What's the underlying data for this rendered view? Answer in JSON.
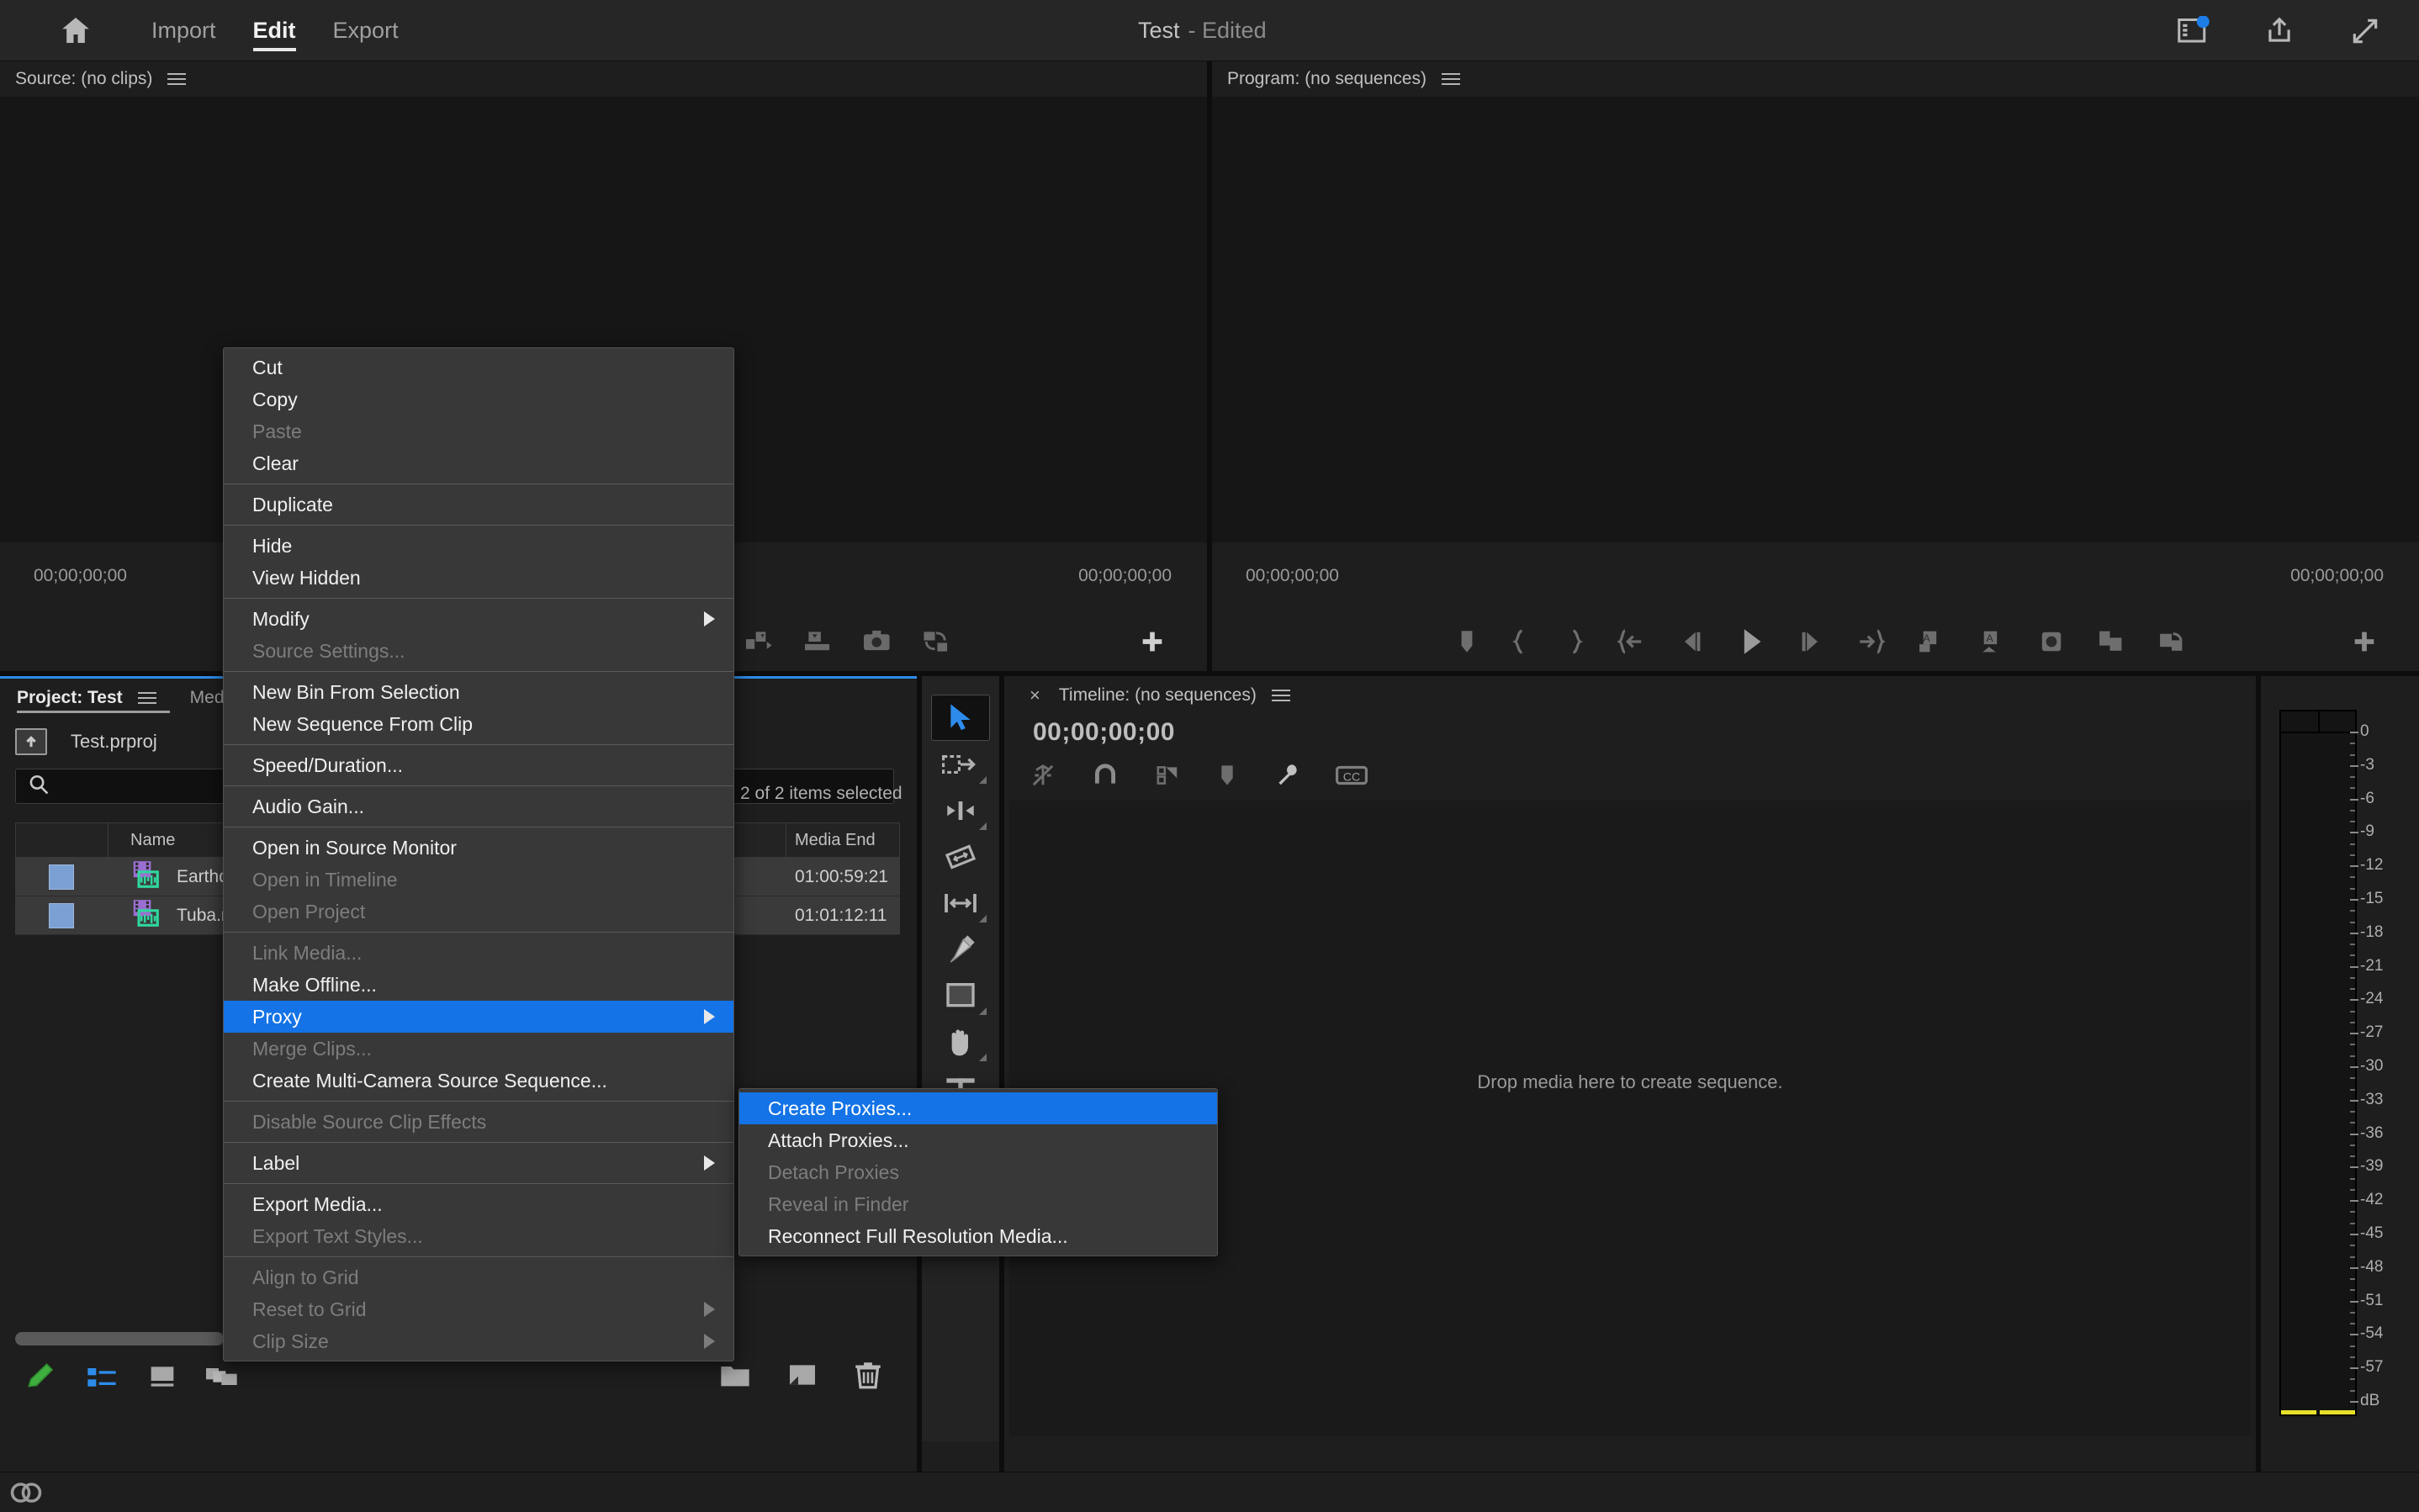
{
  "app": {
    "accent_blue": "#1473e6",
    "panel_bg": "#1e1e1e",
    "menu_bg": "#383838"
  },
  "topbar": {
    "home_icon": "home-icon",
    "tabs": [
      {
        "label": "Import",
        "active": false
      },
      {
        "label": "Edit",
        "active": true
      },
      {
        "label": "Export",
        "active": false
      }
    ],
    "document_name": "Test",
    "document_state": "- Edited",
    "right_icons": [
      {
        "name": "workspaces-icon",
        "badge": true,
        "badge_color": "#1d7ee8"
      },
      {
        "name": "share-icon",
        "badge": false
      },
      {
        "name": "fullscreen-icon",
        "badge": false
      }
    ]
  },
  "source_monitor": {
    "title": "Source: (no clips)",
    "menu_icon": "panel-menu-icon",
    "timecode_left": "00;00;00;00",
    "timecode_right": "00;00;00;00",
    "toolbar_icons": [
      "export-frame-icon",
      "insert-icon",
      "camera-icon",
      "overwrite-icon",
      "button-editor-icon"
    ]
  },
  "program_monitor": {
    "title": "Program: (no sequences)",
    "menu_icon": "panel-menu-icon",
    "timecode_left": "00;00;00;00",
    "timecode_right": "00;00;00;00",
    "toolbar_icons": [
      "add-marker-icon",
      "mark-in-icon",
      "mark-out-icon",
      "go-to-in-icon",
      "step-back-icon",
      "play-icon",
      "step-forward-icon",
      "go-to-out-icon",
      "lift-icon",
      "extract-icon",
      "export-frame-icon",
      "comparison-view-icon",
      "button-editor-icon",
      "add-button-icon"
    ]
  },
  "project_panel": {
    "tabs": [
      {
        "label": "Project: Test",
        "active": true
      },
      {
        "label": "Med",
        "active": false
      }
    ],
    "menu_icon": "panel-menu-icon",
    "breadcrumb_icon": "parent-bin-icon",
    "breadcrumb": "Test.prproj",
    "search_icon": "search-icon",
    "search_placeholder": "",
    "search_value": "",
    "items_selected": "2 of 2 items selected",
    "columns": [
      "",
      "Name",
      "Media End"
    ],
    "rows": [
      {
        "swatch": "#7ba0d4",
        "clip_icon": "video-audio-clip-icon",
        "name": "Earthqu",
        "media_end": "01:00:59:21"
      },
      {
        "swatch": "#7ba0d4",
        "clip_icon": "video-audio-clip-icon",
        "name": "Tuba.mo",
        "media_end": "01:01:12:11"
      }
    ],
    "bottom_icons": [
      "pencil-icon",
      "list-view-icon",
      "icon-view-icon",
      "freeform-view-icon"
    ],
    "right_bottom_icons": [
      "new-bin-icon",
      "new-item-icon",
      "trash-icon"
    ]
  },
  "tools_panel": {
    "tools": [
      {
        "name": "selection-tool",
        "active": true,
        "has_submenu": false
      },
      {
        "name": "track-select-forward-tool",
        "active": false,
        "has_submenu": true
      },
      {
        "name": "ripple-edit-tool",
        "active": false,
        "has_submenu": true
      },
      {
        "name": "rolling-edit-tool",
        "active": false,
        "has_submenu": false
      },
      {
        "name": "rate-stretch-tool",
        "active": false,
        "has_submenu": true
      },
      {
        "name": "pen-tool",
        "active": false,
        "has_submenu": false
      },
      {
        "name": "rectangle-tool",
        "active": false,
        "has_submenu": true
      },
      {
        "name": "hand-tool",
        "active": false,
        "has_submenu": true
      },
      {
        "name": "type-tool",
        "active": false,
        "has_submenu": true
      }
    ]
  },
  "timeline_panel": {
    "close_icon": "close-icon",
    "title": "Timeline: (no sequences)",
    "menu_icon": "panel-menu-icon",
    "timecode": "00;00;00;00",
    "toolbar_icons": [
      "insert-overwrite-icon",
      "snap-icon",
      "linked-selection-icon",
      "add-marker-icon",
      "timeline-settings-icon",
      "captions-icon"
    ],
    "drop_hint": "Drop media here to create sequence."
  },
  "audio_meter": {
    "ticks": [
      "0",
      "-3",
      "-6",
      "-9",
      "-12",
      "-15",
      "-18",
      "-21",
      "-24",
      "-27",
      "-30",
      "-33",
      "-36",
      "-39",
      "-42",
      "-45",
      "-48",
      "-51",
      "-54",
      "-57",
      "dB"
    ],
    "level_color": "#e8e02a"
  },
  "context_menu": {
    "items": [
      {
        "label": "Cut",
        "enabled": true,
        "submenu": false,
        "selected": false
      },
      {
        "label": "Copy",
        "enabled": true,
        "submenu": false,
        "selected": false
      },
      {
        "label": "Paste",
        "enabled": false,
        "submenu": false,
        "selected": false
      },
      {
        "label": "Clear",
        "enabled": true,
        "submenu": false,
        "selected": false
      },
      {
        "separator": true
      },
      {
        "label": "Duplicate",
        "enabled": true,
        "submenu": false,
        "selected": false
      },
      {
        "separator": true
      },
      {
        "label": "Hide",
        "enabled": true,
        "submenu": false,
        "selected": false
      },
      {
        "label": "View Hidden",
        "enabled": true,
        "submenu": false,
        "selected": false
      },
      {
        "separator": true
      },
      {
        "label": "Modify",
        "enabled": true,
        "submenu": true,
        "selected": false
      },
      {
        "label": "Source Settings...",
        "enabled": false,
        "submenu": false,
        "selected": false
      },
      {
        "separator": true
      },
      {
        "label": "New Bin From Selection",
        "enabled": true,
        "submenu": false,
        "selected": false
      },
      {
        "label": "New Sequence From Clip",
        "enabled": true,
        "submenu": false,
        "selected": false
      },
      {
        "separator": true
      },
      {
        "label": "Speed/Duration...",
        "enabled": true,
        "submenu": false,
        "selected": false
      },
      {
        "separator": true
      },
      {
        "label": "Audio Gain...",
        "enabled": true,
        "submenu": false,
        "selected": false
      },
      {
        "separator": true
      },
      {
        "label": "Open in Source Monitor",
        "enabled": true,
        "submenu": false,
        "selected": false
      },
      {
        "label": "Open in Timeline",
        "enabled": false,
        "submenu": false,
        "selected": false
      },
      {
        "label": "Open Project",
        "enabled": false,
        "submenu": false,
        "selected": false
      },
      {
        "separator": true
      },
      {
        "label": "Link Media...",
        "enabled": false,
        "submenu": false,
        "selected": false
      },
      {
        "label": "Make Offline...",
        "enabled": true,
        "submenu": false,
        "selected": false
      },
      {
        "label": "Proxy",
        "enabled": true,
        "submenu": true,
        "selected": true
      },
      {
        "label": "Merge Clips...",
        "enabled": false,
        "submenu": false,
        "selected": false
      },
      {
        "label": "Create Multi-Camera Source Sequence...",
        "enabled": true,
        "submenu": false,
        "selected": false
      },
      {
        "separator": true
      },
      {
        "label": "Disable Source Clip Effects",
        "enabled": false,
        "submenu": false,
        "selected": false
      },
      {
        "separator": true
      },
      {
        "label": "Label",
        "enabled": true,
        "submenu": true,
        "selected": false
      },
      {
        "separator": true
      },
      {
        "label": "Export Media...",
        "enabled": true,
        "submenu": false,
        "selected": false
      },
      {
        "label": "Export Text Styles...",
        "enabled": false,
        "submenu": false,
        "selected": false
      },
      {
        "separator": true
      },
      {
        "label": "Align to Grid",
        "enabled": false,
        "submenu": false,
        "selected": false
      },
      {
        "label": "Reset to Grid",
        "enabled": false,
        "submenu": true,
        "selected": false
      },
      {
        "label": "Clip Size",
        "enabled": false,
        "submenu": true,
        "selected": false
      }
    ]
  },
  "context_submenu": {
    "items": [
      {
        "label": "Create Proxies...",
        "enabled": true,
        "selected": true
      },
      {
        "label": "Attach Proxies...",
        "enabled": true,
        "selected": false
      },
      {
        "label": "Detach Proxies",
        "enabled": false,
        "selected": false
      },
      {
        "label": "Reveal in Finder",
        "enabled": false,
        "selected": false
      },
      {
        "label": "Reconnect Full Resolution Media...",
        "enabled": true,
        "selected": false
      }
    ]
  }
}
